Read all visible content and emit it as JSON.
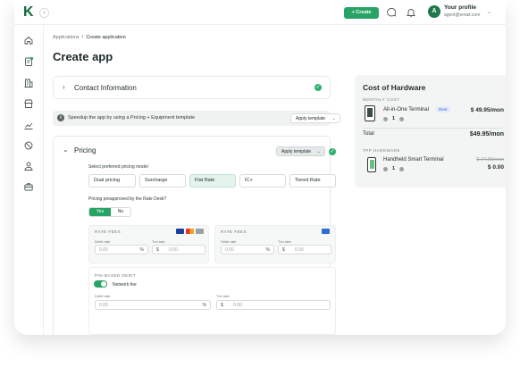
{
  "topbar": {
    "logo": "K",
    "create_label": "+ Create",
    "profile_name": "Your profile",
    "profile_email": "agent@email.com",
    "avatar_initial": "A"
  },
  "breadcrumb": {
    "parent": "Applications",
    "separator": "/",
    "current": "Create application"
  },
  "page_title": "Create app",
  "contact": {
    "title": "Contact Information"
  },
  "banner": {
    "text": "Speedup the app by using a Pricing + Equipment template",
    "button": "Apply template"
  },
  "pricing": {
    "title": "Pricing",
    "apply_button": "Apply template",
    "model_label": "Select preferred pricing model",
    "models": [
      "Dual pricing",
      "Surcharge",
      "Flat Rate",
      "IC+",
      "Tiered Rate"
    ],
    "selected_model": "Flat Rate",
    "preapproved_label": "Pricing preapproved by the Rate Desk?",
    "yes": "Yes",
    "no": "No",
    "fee_boxes": [
      {
        "title": "RATE FEES",
        "debit_label": "Debit rate",
        "debit_value": "0.00",
        "debit_suffix": "%",
        "txn_label": "Txn rate",
        "txn_prefix": "$",
        "txn_value": "0.00"
      },
      {
        "title": "RATE FEES",
        "debit_label": "Debit rate",
        "debit_value": "0.00",
        "debit_suffix": "%",
        "txn_label": "Txn rate",
        "txn_prefix": "$",
        "txn_value": "0.00"
      }
    ],
    "pin": {
      "title": "PIN-BASED DEBIT",
      "network_fee": "Network fee",
      "debit_label": "Debit rate",
      "debit_value": "0.00",
      "debit_suffix": "%",
      "txn_label": "Txn rate",
      "txn_prefix": "$",
      "txn_value": "0.00"
    }
  },
  "hardware": {
    "title": "Cost of Hardware",
    "monthly_caption": "MONTHLY COST",
    "item1": {
      "name": "All-in-One Terminal",
      "tag": "Rent",
      "price": "$ 49.95/mon",
      "qty": "1"
    },
    "total_label": "Total",
    "total_value": "$49.95/mon",
    "tpp_caption": "TPP HARDWARE",
    "item2": {
      "name": "Handheld Smart Terminal",
      "old_price": "$ 24.95/mon",
      "price": "$ 0.00",
      "qty": "1"
    }
  },
  "colors": {
    "accent": "#27a366",
    "brand": "#0d6b3a"
  }
}
